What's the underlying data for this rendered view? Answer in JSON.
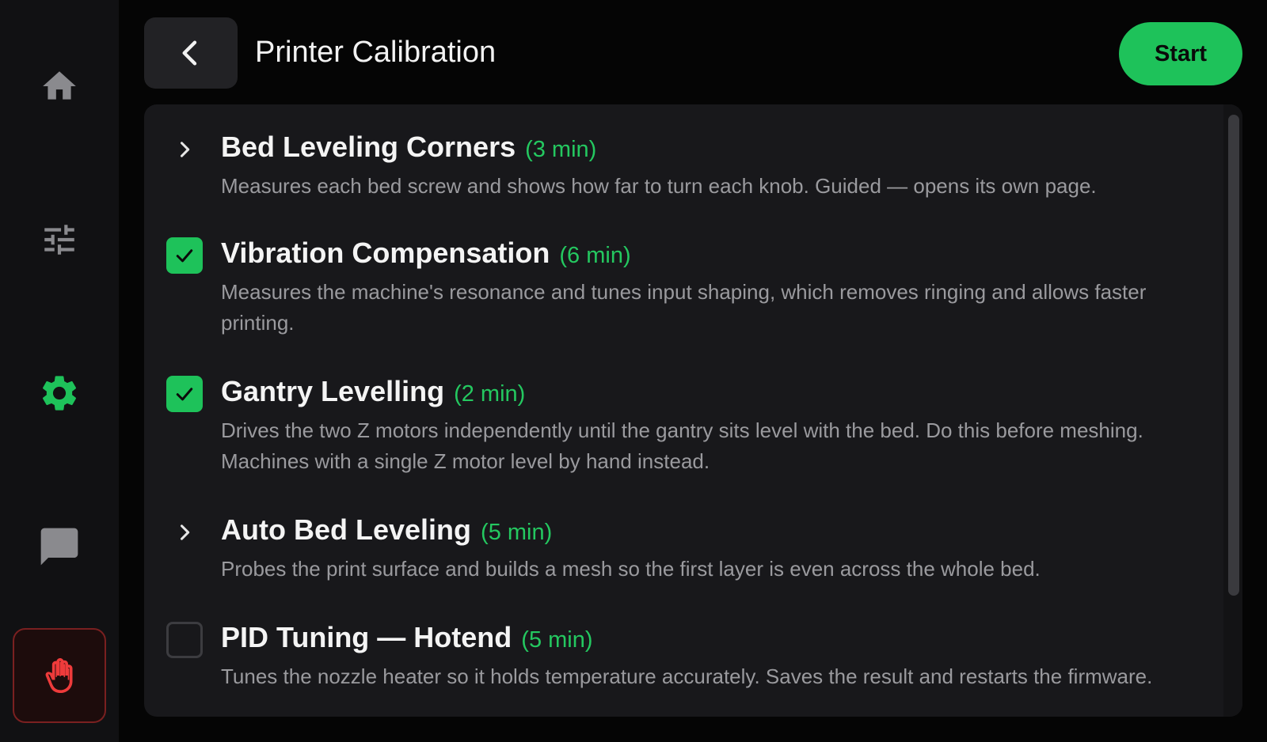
{
  "sidebar": {
    "items": [
      {
        "icon": "home-icon",
        "state": "inactive"
      },
      {
        "icon": "sliders-icon",
        "state": "inactive"
      },
      {
        "icon": "gear-icon",
        "state": "active"
      },
      {
        "icon": "chat-icon",
        "state": "inactive"
      },
      {
        "icon": "hand-stop-icon",
        "state": "emergency"
      }
    ]
  },
  "header": {
    "back_icon": "chevron-left-icon",
    "title": "Printer Calibration",
    "start_label": "Start"
  },
  "calibration": {
    "items": [
      {
        "name": "Bed Leveling Corners",
        "duration": "(3 min)",
        "description": "Measures each bed screw and shows how far to turn each knob. Guided — opens its own page.",
        "control": "expand"
      },
      {
        "name": "Vibration Compensation",
        "duration": "(6 min)",
        "description": "Measures the machine's resonance and tunes input shaping, which removes ringing and allows faster printing.",
        "control": "checked"
      },
      {
        "name": "Gantry Levelling",
        "duration": "(2 min)",
        "description": "Drives the two Z motors independently until the gantry sits level with the bed. Do this before meshing. Machines with a single Z motor level by hand instead.",
        "control": "checked"
      },
      {
        "name": "Auto Bed Leveling",
        "duration": "(5 min)",
        "description": "Probes the print surface and builds a mesh so the first layer is even across the whole bed.",
        "control": "expand"
      },
      {
        "name": "PID Tuning — Hotend",
        "duration": "(5 min)",
        "description": "Tunes the nozzle heater so it holds temperature accurately. Saves the result and restarts the firmware.",
        "control": "unchecked"
      }
    ]
  },
  "colors": {
    "accent": "#1ec25a",
    "background": "#050505",
    "panel": "#18181b",
    "sidebar": "#111113",
    "danger": "#e53935"
  }
}
